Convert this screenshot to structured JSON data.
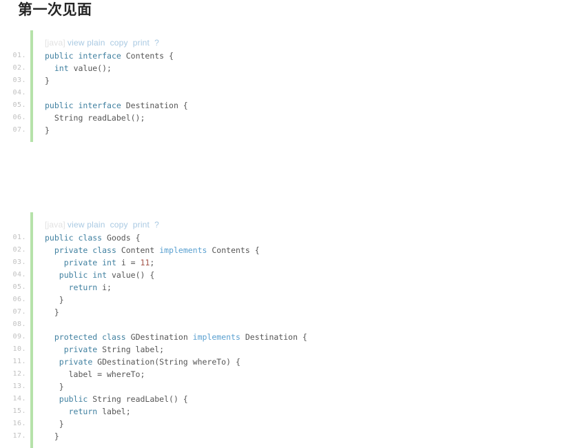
{
  "page": {
    "title": "第一次见面",
    "background_color": "#ffffff",
    "title_color": "#262626"
  },
  "watermarks": [
    {
      "text": "JA",
      "color": "#fcfcfc"
    },
    {
      "text": "JA",
      "color": "#fcfcfc"
    }
  ],
  "toolbar": {
    "language_label": "[java]",
    "links": [
      "view plain",
      "copy",
      "print",
      "?"
    ],
    "link_color": "#a9c9e2",
    "language_color": "#e2e2e2"
  },
  "colors": {
    "gutter": "#c0c0c0",
    "left_bar_green": "#b6e2aa",
    "keyword": "#4080a0",
    "implements_keyword": "#5aa0d0",
    "identifier": "#555555",
    "number_literal": "#a4564a"
  },
  "code_blocks": [
    {
      "id": "code-block-1",
      "language": "java",
      "toolbar": {
        "language_label": "[java]",
        "link_view_plain": "view plain",
        "link_copy": "copy",
        "link_print": "print",
        "link_help": "?"
      },
      "line_numbers": [
        "01.",
        "02.",
        "03.",
        "04.",
        "05.",
        "06.",
        "07."
      ],
      "lines": [
        {
          "number": "01.",
          "tokens": [
            {
              "text": "public",
              "type": "keyword"
            },
            {
              "text": " ",
              "type": "plain"
            },
            {
              "text": "interface",
              "type": "keyword"
            },
            {
              "text": " Contents {",
              "type": "plain"
            }
          ]
        },
        {
          "number": "02.",
          "tokens": [
            {
              "text": "  ",
              "type": "plain"
            },
            {
              "text": "int",
              "type": "keyword"
            },
            {
              "text": " value();",
              "type": "plain"
            }
          ]
        },
        {
          "number": "03.",
          "tokens": [
            {
              "text": "}",
              "type": "plain"
            }
          ]
        },
        {
          "number": "04.",
          "tokens": [
            {
              "text": "",
              "type": "plain"
            }
          ]
        },
        {
          "number": "05.",
          "tokens": [
            {
              "text": "public",
              "type": "keyword"
            },
            {
              "text": " ",
              "type": "plain"
            },
            {
              "text": "interface",
              "type": "keyword"
            },
            {
              "text": " Destination {",
              "type": "plain"
            }
          ]
        },
        {
          "number": "06.",
          "tokens": [
            {
              "text": "  String readLabel();",
              "type": "plain"
            }
          ]
        },
        {
          "number": "07.",
          "tokens": [
            {
              "text": "}",
              "type": "plain"
            }
          ]
        }
      ]
    },
    {
      "id": "code-block-2",
      "language": "java",
      "toolbar": {
        "language_label": "[java]",
        "link_view_plain": "view plain",
        "link_copy": "copy",
        "link_print": "print",
        "link_help": "?"
      },
      "line_numbers": [
        "01.",
        "02.",
        "03.",
        "04.",
        "05.",
        "06.",
        "07.",
        "08.",
        "09.",
        "10.",
        "11.",
        "12.",
        "13.",
        "14.",
        "15.",
        "16.",
        "17."
      ],
      "lines": [
        {
          "number": "01.",
          "tokens": [
            {
              "text": "public",
              "type": "keyword"
            },
            {
              "text": " ",
              "type": "plain"
            },
            {
              "text": "class",
              "type": "keyword"
            },
            {
              "text": " Goods {",
              "type": "plain"
            }
          ]
        },
        {
          "number": "02.",
          "tokens": [
            {
              "text": "  ",
              "type": "plain"
            },
            {
              "text": "private",
              "type": "keyword"
            },
            {
              "text": " ",
              "type": "plain"
            },
            {
              "text": "class",
              "type": "keyword"
            },
            {
              "text": " Content ",
              "type": "plain"
            },
            {
              "text": "implements",
              "type": "imp"
            },
            {
              "text": " Contents {",
              "type": "plain"
            }
          ]
        },
        {
          "number": "03.",
          "tokens": [
            {
              "text": "    ",
              "type": "plain"
            },
            {
              "text": "private",
              "type": "keyword"
            },
            {
              "text": " ",
              "type": "plain"
            },
            {
              "text": "int",
              "type": "keyword"
            },
            {
              "text": " i = ",
              "type": "plain"
            },
            {
              "text": "11",
              "type": "num"
            },
            {
              "text": ";",
              "type": "plain"
            }
          ]
        },
        {
          "number": "04.",
          "tokens": [
            {
              "text": "   ",
              "type": "plain"
            },
            {
              "text": "public",
              "type": "keyword"
            },
            {
              "text": " ",
              "type": "plain"
            },
            {
              "text": "int",
              "type": "keyword"
            },
            {
              "text": " value() {",
              "type": "plain"
            }
          ]
        },
        {
          "number": "05.",
          "tokens": [
            {
              "text": "     ",
              "type": "plain"
            },
            {
              "text": "return",
              "type": "keyword"
            },
            {
              "text": " i;",
              "type": "plain"
            }
          ]
        },
        {
          "number": "06.",
          "tokens": [
            {
              "text": "   }",
              "type": "plain"
            }
          ]
        },
        {
          "number": "07.",
          "tokens": [
            {
              "text": "  }",
              "type": "plain"
            }
          ]
        },
        {
          "number": "08.",
          "tokens": [
            {
              "text": "",
              "type": "plain"
            }
          ]
        },
        {
          "number": "09.",
          "tokens": [
            {
              "text": "  ",
              "type": "plain"
            },
            {
              "text": "protected",
              "type": "keyword"
            },
            {
              "text": " ",
              "type": "plain"
            },
            {
              "text": "class",
              "type": "keyword"
            },
            {
              "text": " GDestination ",
              "type": "plain"
            },
            {
              "text": "implements",
              "type": "imp"
            },
            {
              "text": " Destination {",
              "type": "plain"
            }
          ]
        },
        {
          "number": "10.",
          "tokens": [
            {
              "text": "    ",
              "type": "plain"
            },
            {
              "text": "private",
              "type": "keyword"
            },
            {
              "text": " String label;",
              "type": "plain"
            }
          ]
        },
        {
          "number": "11.",
          "tokens": [
            {
              "text": "   ",
              "type": "plain"
            },
            {
              "text": "private",
              "type": "keyword"
            },
            {
              "text": " GDestination(String whereTo) {",
              "type": "plain"
            }
          ]
        },
        {
          "number": "12.",
          "tokens": [
            {
              "text": "     label = whereTo;",
              "type": "plain"
            }
          ]
        },
        {
          "number": "13.",
          "tokens": [
            {
              "text": "   }",
              "type": "plain"
            }
          ]
        },
        {
          "number": "14.",
          "tokens": [
            {
              "text": "   ",
              "type": "plain"
            },
            {
              "text": "public",
              "type": "keyword"
            },
            {
              "text": " String readLabel() {",
              "type": "plain"
            }
          ]
        },
        {
          "number": "15.",
          "tokens": [
            {
              "text": "     ",
              "type": "plain"
            },
            {
              "text": "return",
              "type": "keyword"
            },
            {
              "text": " label;",
              "type": "plain"
            }
          ]
        },
        {
          "number": "16.",
          "tokens": [
            {
              "text": "   }",
              "type": "plain"
            }
          ]
        },
        {
          "number": "17.",
          "tokens": [
            {
              "text": "  }",
              "type": "plain"
            }
          ]
        }
      ]
    }
  ]
}
